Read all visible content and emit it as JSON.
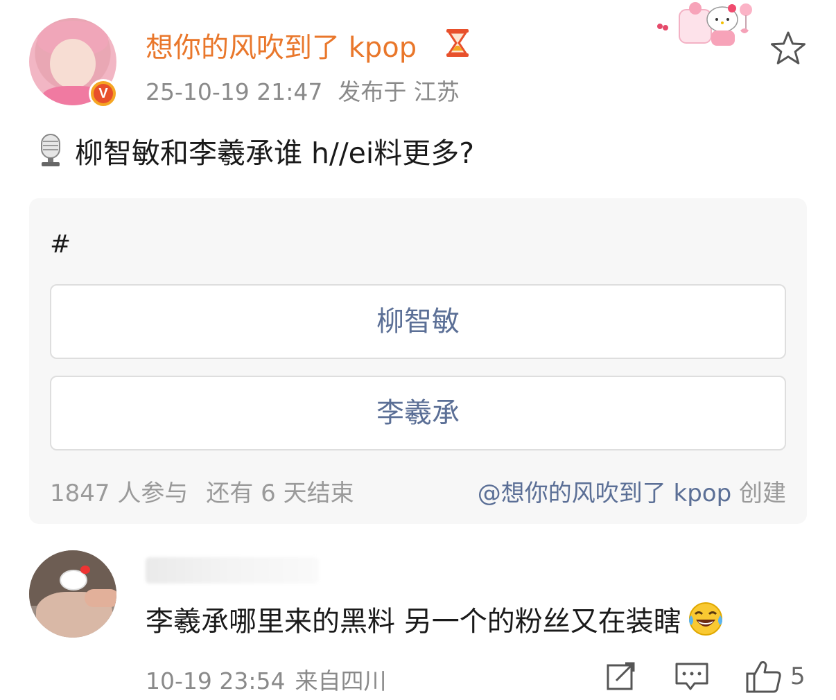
{
  "post": {
    "author_name": "想你的风吹到了 kpop",
    "time": "25-10-19 21:47",
    "location": "发布于 江苏",
    "text": "柳智敏和李羲承谁 h//ei料更多?"
  },
  "poll": {
    "tag": "#",
    "options": [
      {
        "label": "柳智敏"
      },
      {
        "label": "李羲承"
      }
    ],
    "participants": "1847 人参与",
    "ends": "还有 6 天结束",
    "creator_mention": "@想你的风吹到了 kpop",
    "creator_suffix": " 创建"
  },
  "comment": {
    "text": "李羲承哪里来的黑料 另一个的粉丝又在装瞎",
    "time": "10-19 23:54",
    "location": "来自四川",
    "like_count": "5"
  },
  "colors": {
    "author_name": "#e9772b",
    "poll_option_text": "#5b6f96",
    "meta_text": "#8a8a8a",
    "poll_background": "#f7f7f7"
  },
  "icons": {
    "verified": "verified-v-badge-icon",
    "hourglass": "hourglass-icon",
    "favorite": "star-icon",
    "microphone": "microphone-icon",
    "emoji": "laugh-cry-emoji-icon",
    "repost": "repost-icon",
    "reply": "reply-icon",
    "like": "thumbs-up-icon"
  },
  "badge_letter": "V"
}
